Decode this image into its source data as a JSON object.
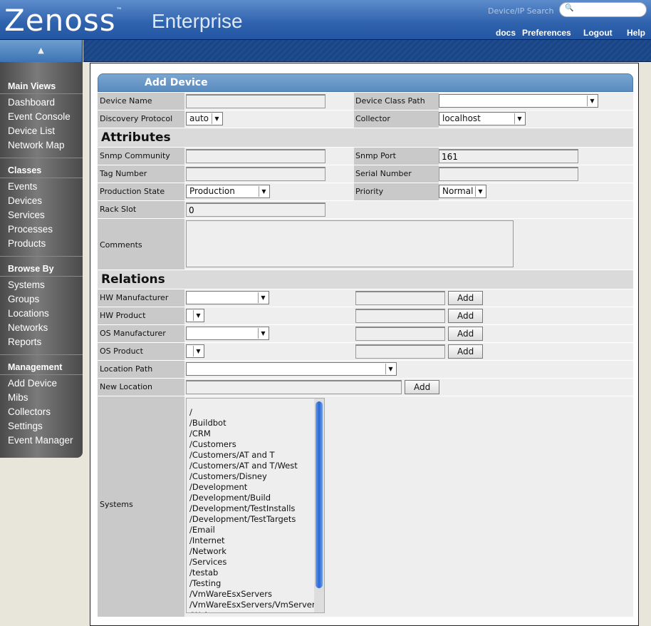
{
  "header": {
    "logo": "Zenoss",
    "tm": "™",
    "edition": "Enterprise",
    "search_label": "Device/IP Search",
    "links": [
      "docs",
      "Preferences",
      "Logout",
      "Help"
    ]
  },
  "sidebar": [
    {
      "title": "Main Views",
      "items": [
        "Dashboard",
        "Event Console",
        "Device List",
        "Network Map"
      ]
    },
    {
      "title": "Classes",
      "items": [
        "Events",
        "Devices",
        "Services",
        "Processes",
        "Products"
      ]
    },
    {
      "title": "Browse By",
      "items": [
        "Systems",
        "Groups",
        "Locations",
        "Networks",
        "Reports"
      ]
    },
    {
      "title": "Management",
      "items": [
        "Add Device",
        "Mibs",
        "Collectors",
        "Settings",
        "Event Manager"
      ]
    }
  ],
  "form": {
    "title": "Add Device",
    "device_name": "Device Name",
    "device_class_path": "Device Class Path",
    "discovery_protocol": "Discovery Protocol",
    "discovery_value": "auto",
    "collector": "Collector",
    "collector_value": "localhost",
    "attributes": "Attributes",
    "snmp_community": "Snmp Community",
    "snmp_port": "Snmp Port",
    "snmp_port_value": "161",
    "tag_number": "Tag Number",
    "serial_number": "Serial Number",
    "production_state": "Production State",
    "production_value": "Production",
    "priority": "Priority",
    "priority_value": "Normal",
    "rack_slot": "Rack Slot",
    "rack_slot_value": "0",
    "comments": "Comments",
    "relations": "Relations",
    "hw_manufacturer": "HW Manufacturer",
    "hw_product": "HW Product",
    "os_manufacturer": "OS Manufacturer",
    "os_product": "OS Product",
    "location_path": "Location Path",
    "new_location": "New Location",
    "systems": "Systems",
    "add": "Add",
    "systems_options": [
      "/",
      "/Buildbot",
      "/CRM",
      "/Customers",
      "/Customers/AT and T",
      "/Customers/AT and T/West",
      "/Customers/Disney",
      "/Development",
      "/Development/Build",
      "/Development/TestInstalls",
      "/Development/TestTargets",
      "/Email",
      "/Internet",
      "/Network",
      "/Services",
      "/testab",
      "/Testing",
      "/VmWareEsxServers",
      "/VmWareEsxServers/VmServer",
      "/Web"
    ]
  }
}
